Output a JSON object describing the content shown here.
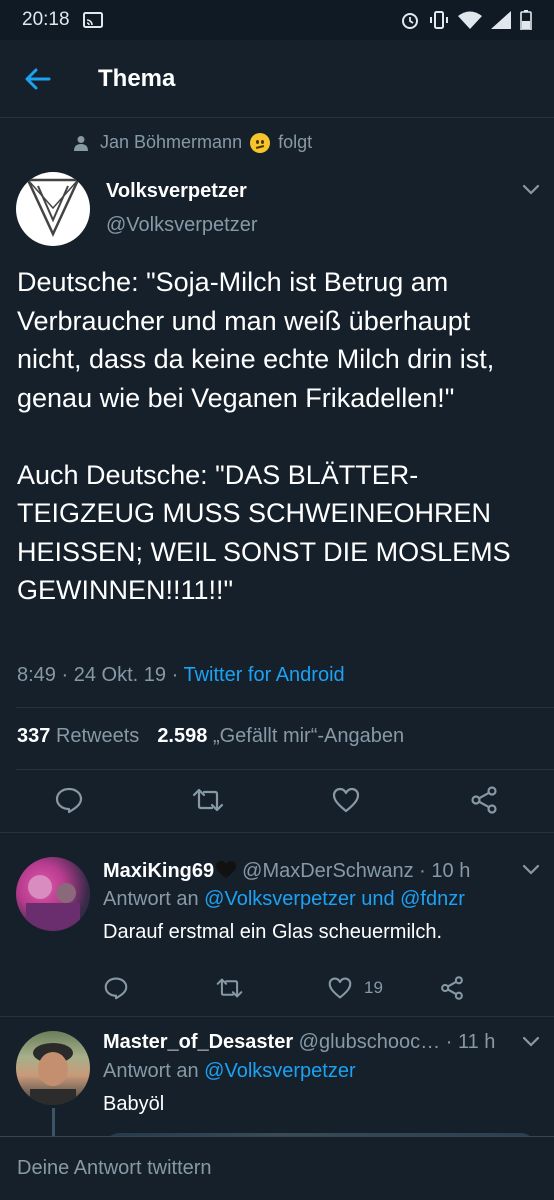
{
  "status_bar": {
    "time": "20:18",
    "icons": [
      "screen-cast-icon",
      "alarm-icon",
      "vibrate-icon",
      "wifi-icon",
      "signal-icon",
      "battery-icon"
    ]
  },
  "header": {
    "title": "Thema",
    "back_icon": "arrow-left-icon"
  },
  "social_context": {
    "name": "Jan Böhmermann",
    "verb": "folgt",
    "emoji": "confused-face-emoji"
  },
  "main_tweet": {
    "author_name": "Volksverpetzer",
    "author_handle": "@Volksverpetzer",
    "text": "Deutsche: \"Soja-Milch ist Betrug am Verbraucher und man weiß überhaupt nicht, dass da keine echte Milch drin ist, genau wie bei Veganen Frikadellen!\"\n\nAuch Deutsche: \"DAS BLÄTTER-TEIGZEUG MUSS SCHWEINEOHREN HEISSEN; WEIL SONST DIE MOSLEMS GEWINNEN!!11!!\"",
    "time": "8:49",
    "date": "24 Okt. 19",
    "separator": "·",
    "client": "Twitter for Android",
    "retweets_count": "337",
    "retweets_label": "Retweets",
    "likes_count": "2.598",
    "likes_label": "„Gefällt mir“-Angaben"
  },
  "replies": [
    {
      "author_name": "MaxiKing69",
      "author_emoji": "black-heart-emoji",
      "author_handle": "@MaxDerSchwanz",
      "time": "10 h",
      "reply_to_prefix": "Antwort an",
      "reply_to_targets": "@Volksverpetzer und @fdnzr",
      "text": "Darauf erstmal ein Glas scheuermilch.",
      "likes": "19"
    },
    {
      "author_name": "Master_of_Desaster",
      "author_handle": "@glubschooc…",
      "time": "11 h",
      "reply_to_prefix": "Antwort an",
      "reply_to_targets": "@Volksverpetzer",
      "text": "Babyöl"
    }
  ],
  "compose": {
    "placeholder": "Deine Antwort twittern"
  },
  "colors": {
    "background": "#15202b",
    "accent": "#1da1f2",
    "secondary_text": "#8899a6",
    "divider": "#253341"
  }
}
